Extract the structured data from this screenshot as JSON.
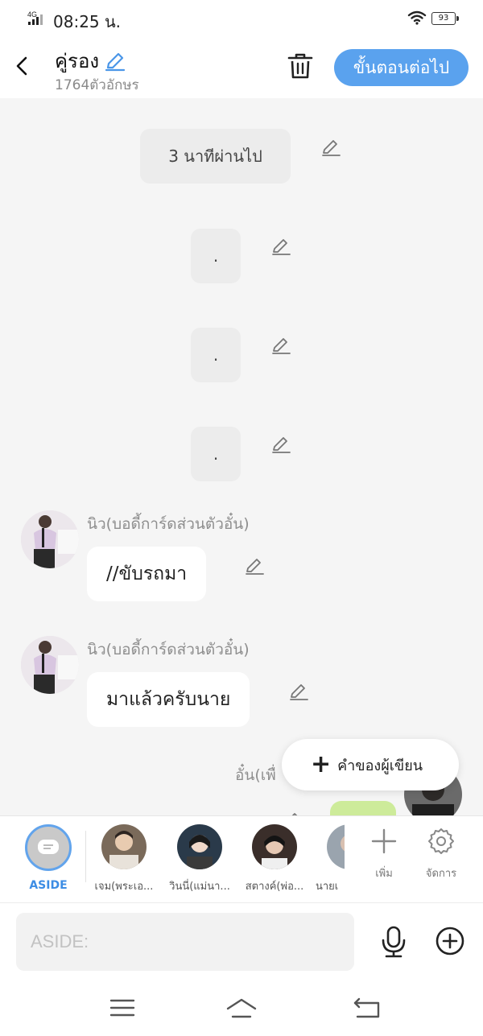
{
  "status_bar": {
    "network": "4G",
    "time": "08:25 น.",
    "battery": "93"
  },
  "header": {
    "title": "คู่รอง",
    "char_count": "1764ตัวอักษร",
    "next_button": "ขั้นตอนต่อไป"
  },
  "chat": {
    "narrations": [
      "3 นาทีผ่านไป",
      ".",
      ".",
      "."
    ],
    "messages": [
      {
        "speaker": "นิว(บอดี้การ์ดส่วนตัวอั๋น)",
        "text": "//ขับรถมา"
      },
      {
        "speaker": "นิว(บอดี้การ์ดส่วนตัวอั๋น)",
        "text": "มาแล้วครับนาย"
      },
      {
        "speaker": "อั๋น(เพื่"
      }
    ],
    "author_note_button": "คำของผู้เขียน"
  },
  "characters": {
    "aside_label": "ASIDE",
    "items": [
      {
        "name": "เจม(พระเอ..."
      },
      {
        "name": "วินนี่(แม่นา..."
      },
      {
        "name": "สตางค์(พ่อ..."
      },
      {
        "name": "นายเ"
      }
    ],
    "add_label": "เพิ่ม",
    "manage_label": "จัดการ"
  },
  "input": {
    "placeholder": "ASIDE:"
  },
  "colors": {
    "accent": "#5aa2ee",
    "aside_label": "#3d8de4",
    "chat_bg": "#f5f5f5",
    "narration_bg": "#ececec"
  }
}
